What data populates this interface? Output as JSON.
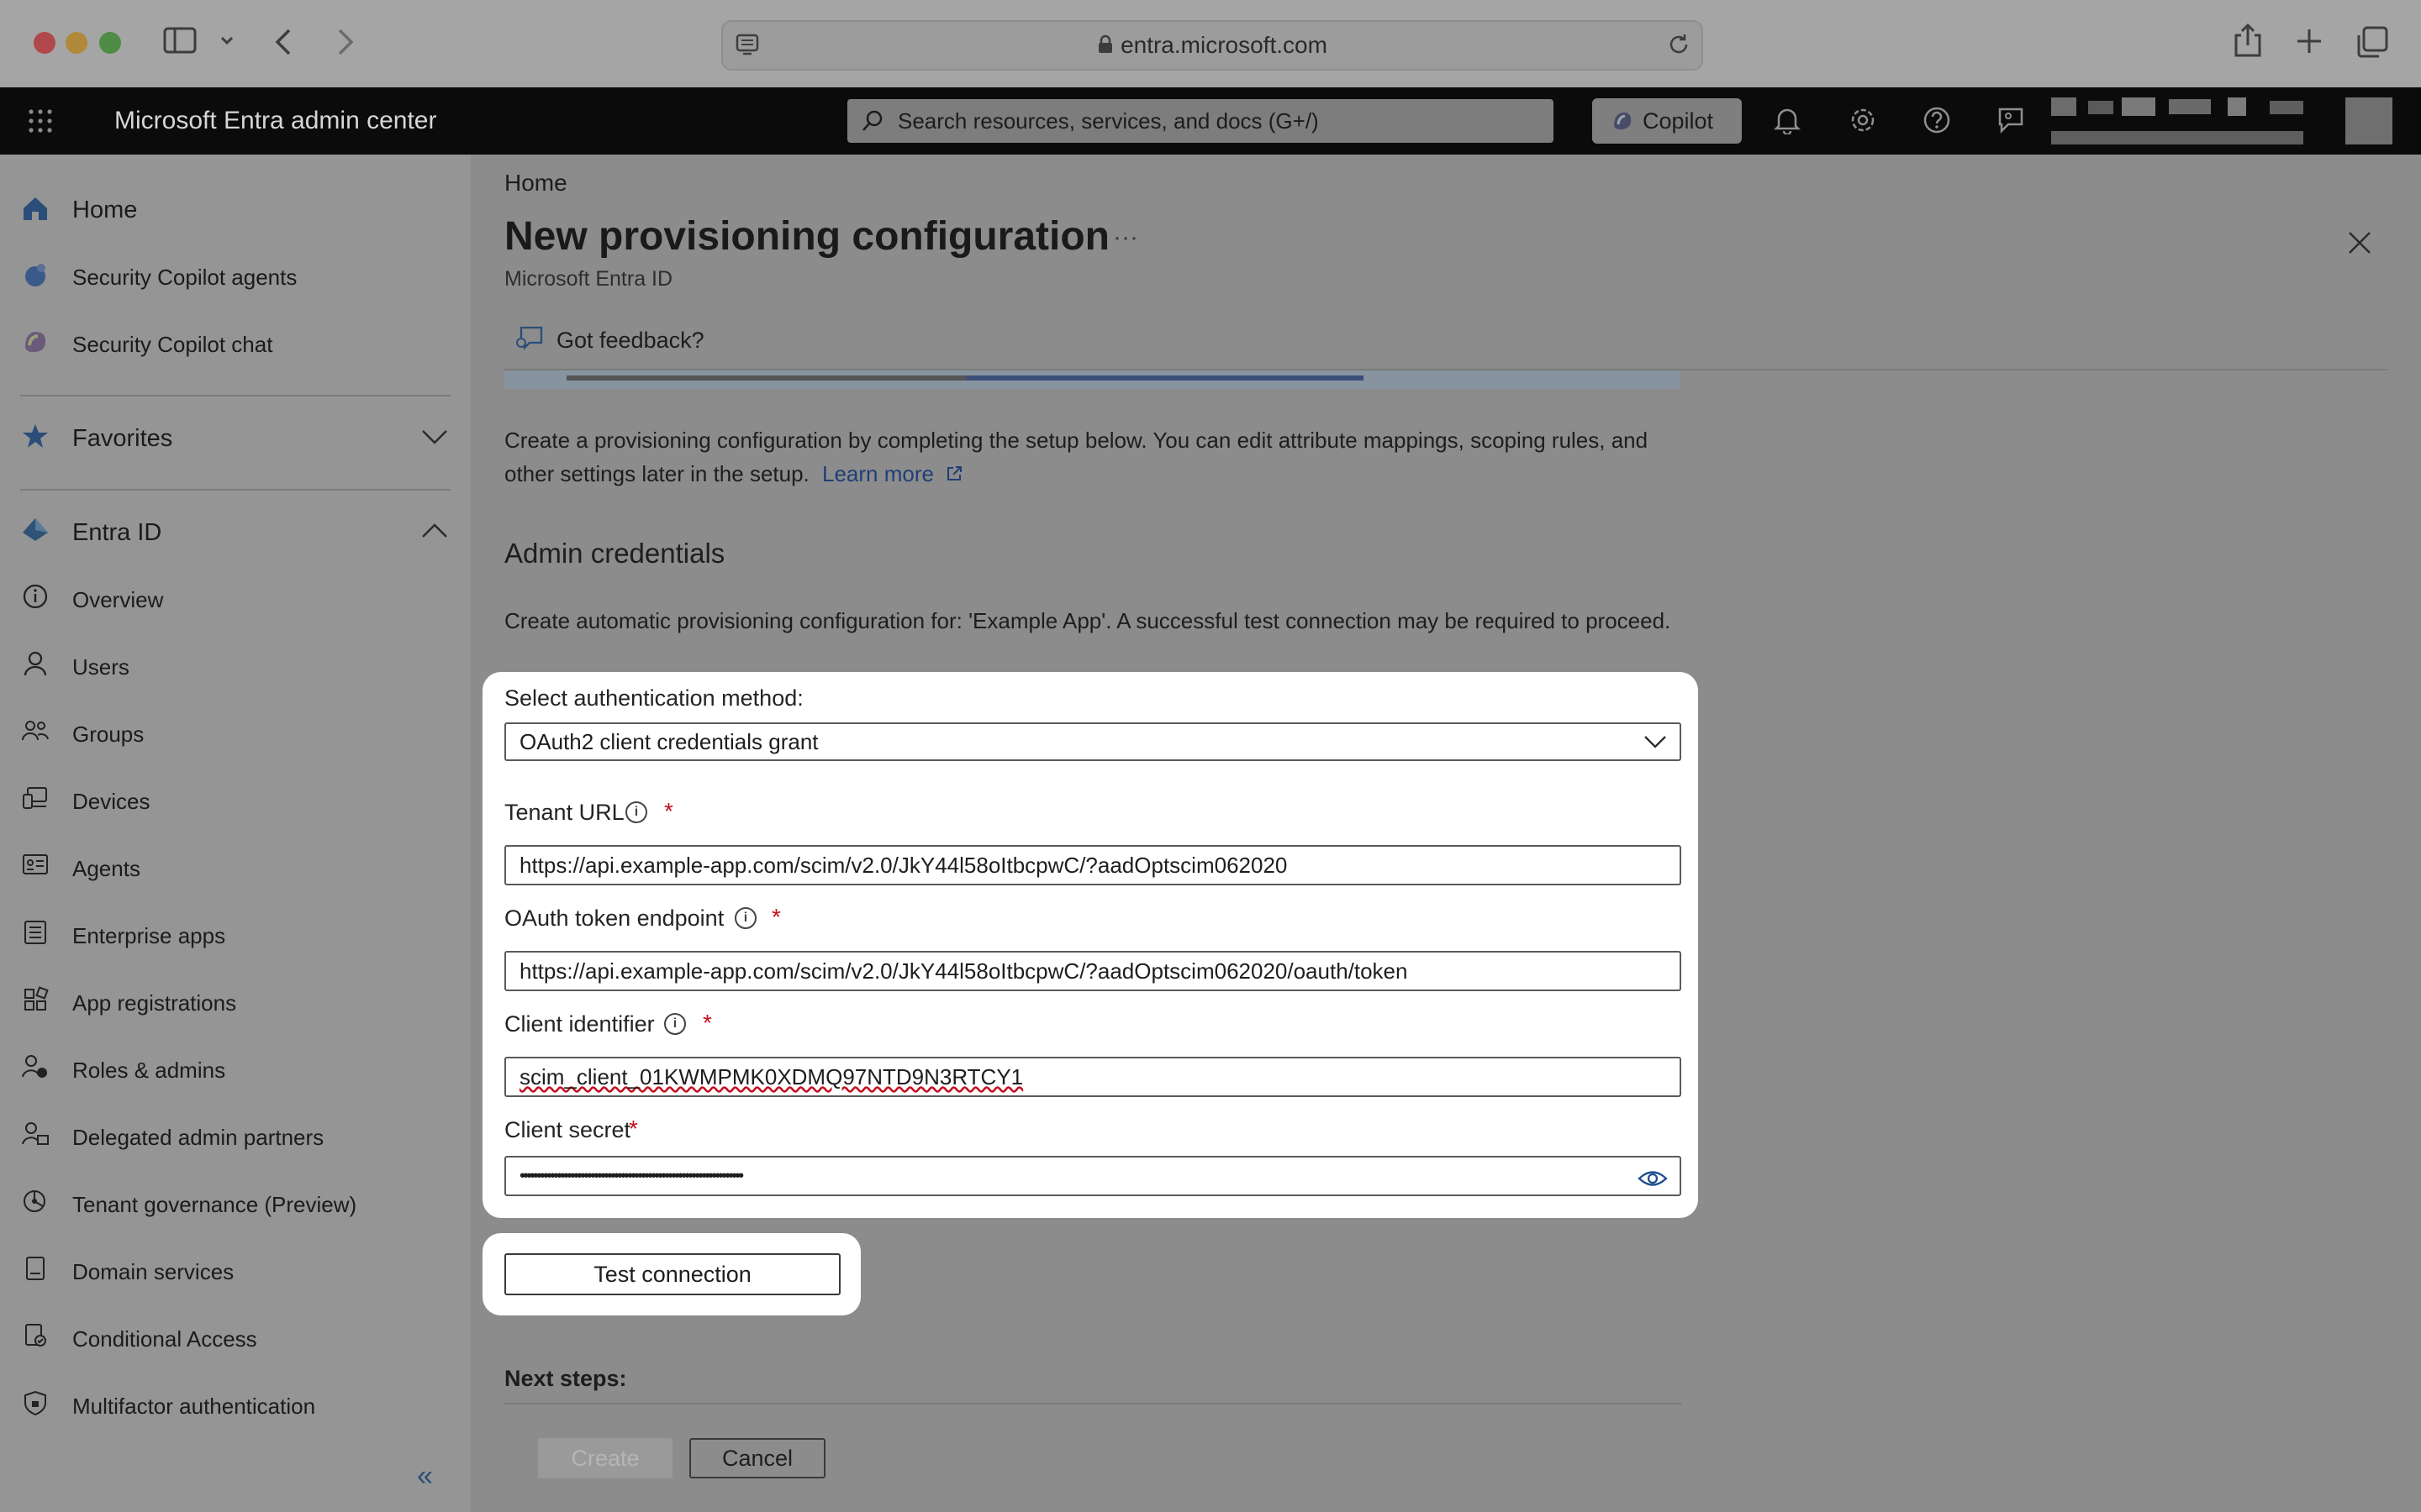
{
  "browser": {
    "url": "entra.microsoft.com",
    "icons": [
      "close-dot",
      "minimize-dot",
      "maximize-dot",
      "sidebar-toggle-icon",
      "chevron-down-icon",
      "back-icon",
      "forward-icon",
      "reader-icon",
      "lock-icon",
      "reload-icon",
      "share-icon",
      "new-tab-icon",
      "tab-overview-icon"
    ]
  },
  "header": {
    "title": "Microsoft Entra admin center",
    "search_placeholder": "Search resources, services, and docs (G+/)",
    "copilot_label": "Copilot"
  },
  "sidebar": {
    "top": [
      {
        "label": "Home",
        "icon": "home-icon"
      },
      {
        "label": "Security Copilot agents",
        "icon": "security-copilot-icon"
      },
      {
        "label": "Security Copilot chat",
        "icon": "copilot-chat-icon"
      }
    ],
    "favorites": {
      "label": "Favorites",
      "icon": "star-icon"
    },
    "entra": {
      "label": "Entra ID",
      "icon": "entra-diamond-icon"
    },
    "items": [
      {
        "label": "Overview",
        "icon": "info-icon"
      },
      {
        "label": "Users",
        "icon": "user-icon"
      },
      {
        "label": "Groups",
        "icon": "groups-icon"
      },
      {
        "label": "Devices",
        "icon": "devices-icon"
      },
      {
        "label": "Agents",
        "icon": "agents-icon"
      },
      {
        "label": "Enterprise apps",
        "icon": "enterprise-apps-icon"
      },
      {
        "label": "App registrations",
        "icon": "app-registrations-icon"
      },
      {
        "label": "Roles & admins",
        "icon": "roles-icon"
      },
      {
        "label": "Delegated admin partners",
        "icon": "delegated-admin-icon"
      },
      {
        "label": "Tenant governance (Preview)",
        "icon": "tenant-governance-icon"
      },
      {
        "label": "Domain services",
        "icon": "domain-services-icon"
      },
      {
        "label": "Conditional Access",
        "icon": "conditional-access-icon"
      },
      {
        "label": "Multifactor authentication",
        "icon": "mfa-shield-icon"
      }
    ],
    "collapse": "«"
  },
  "main": {
    "breadcrumb": "Home",
    "title": "New provisioning configuration",
    "more": "···",
    "subtitle": "Microsoft Entra ID",
    "feedback": "Got feedback?",
    "description_line1": "Create a provisioning configuration by completing the setup below. You can edit attribute mappings, scoping rules, and",
    "description_line2": "other settings later in the setup.",
    "learn_more": "Learn more",
    "section_title": "Admin credentials",
    "section_desc": "Create automatic provisioning configuration for: 'Example App'. A successful test connection may be required to proceed.",
    "auth_label": "Select authentication method:",
    "auth_value": "OAuth2 client credentials grant",
    "tenant_url_label": "Tenant URL",
    "tenant_url_value": "https://api.example-app.com/scim/v2.0/JkY44l58oItbcpwC/?aadOptscim062020",
    "token_endpoint_label": "OAuth token endpoint",
    "token_endpoint_value": "https://api.example-app.com/scim/v2.0/JkY44l58oItbcpwC/?aadOptscim062020/oauth/token",
    "client_id_label": "Client identifier",
    "client_id_value": "scim_client_01KWMPMK0XDMQ97NTD9N3RTCY1",
    "client_secret_label": "Client secret",
    "client_secret_value": "••••••••••••••••••••••••••••••••••••••••••••••••••••••••••••••••••",
    "required_mark": "*",
    "test_connection": "Test connection",
    "next_steps": "Next steps:",
    "create": "Create",
    "cancel": "Cancel"
  }
}
